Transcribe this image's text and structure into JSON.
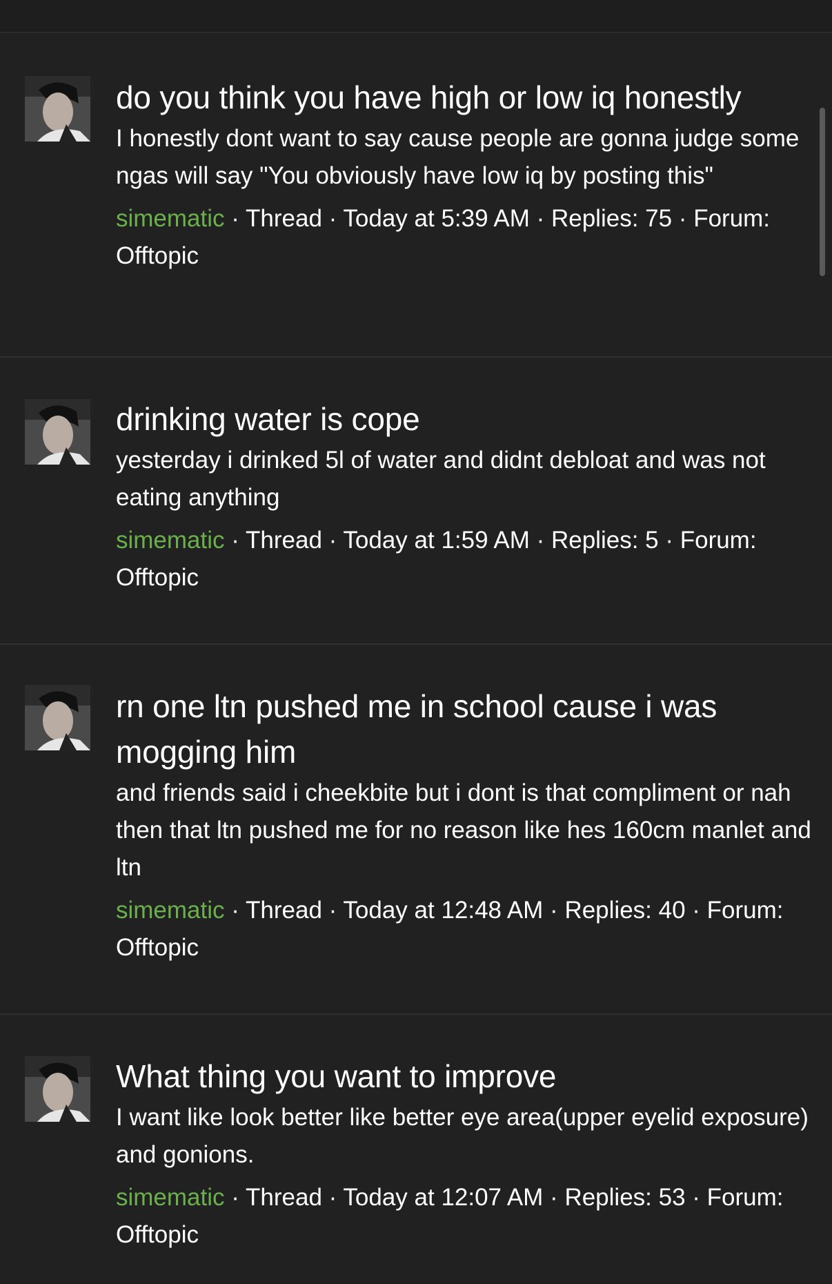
{
  "author": "simematic",
  "threads": [
    {
      "title": "do you think you have high or low iq honestly",
      "snippet": "I honestly dont want to say cause people are gonna judge some ngas will say \"You obviously have low iq by posting this\"",
      "type": "Thread",
      "time": "Today at 5:39 AM",
      "replies": "Replies: 75",
      "forum": "Forum: Offtopic"
    },
    {
      "title": "drinking water is cope",
      "snippet": "yesterday i drinked 5l of water and didnt debloat and was not eating anything",
      "type": "Thread",
      "time": "Today at 1:59 AM",
      "replies": "Replies: 5",
      "forum": "Forum: Offtopic"
    },
    {
      "title": "rn one ltn pushed me in school cause i was mogging him",
      "snippet": "and friends said i cheekbite but i dont is that compliment or nah then that ltn pushed me for no reason like hes 160cm manlet and ltn",
      "type": "Thread",
      "time": "Today at 12:48 AM",
      "replies": "Replies: 40",
      "forum": "Forum: Offtopic"
    },
    {
      "title": "What thing you want to improve",
      "snippet": "I want like look better like better eye area(upper eyelid exposure) and gonions.",
      "type": "Thread",
      "time": "Today at 12:07 AM",
      "replies": "Replies: 53",
      "forum": "Forum: Offtopic"
    }
  ],
  "colors": {
    "background": "#212121",
    "username": "#6ab04c",
    "text": "#ffffff"
  }
}
